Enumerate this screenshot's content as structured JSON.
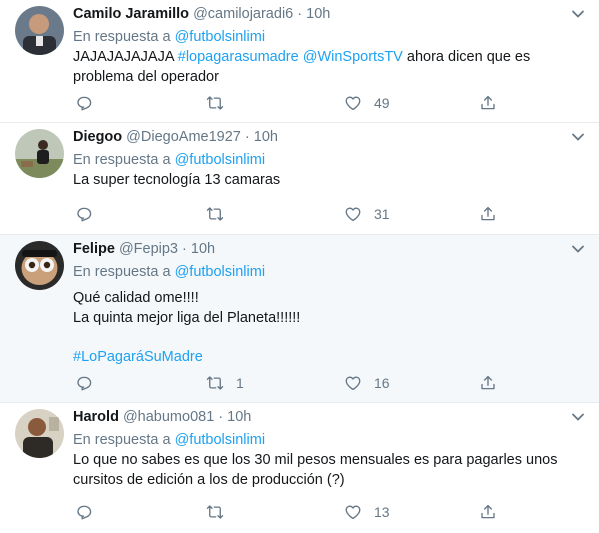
{
  "reply_prefix": "En respuesta a",
  "tweets": [
    {
      "name": "Camilo Jaramillo",
      "handle": "@camilojaradi6",
      "dot": "·",
      "time": "10h",
      "reply_to": "@futbolsinlimi",
      "text_html": "JAJAJAJAJAJA <span class=\"link\">#lopagarasumadre</span> <span class=\"link\">@WinSportsTV</span> ahora dicen que es problema del operador",
      "retweets": "",
      "likes": "49"
    },
    {
      "name": "Diegoo",
      "handle": "@DiegoAme1927",
      "dot": "·",
      "time": "10h",
      "reply_to": "@futbolsinlimi",
      "text_html": "La super tecnología 13 camaras",
      "retweets": "",
      "likes": "31"
    },
    {
      "name": "Felipe",
      "handle": "@Fepip3",
      "dot": "·",
      "time": "10h",
      "reply_to": "@futbolsinlimi",
      "text_html": "<p>Qué calidad ome!!!!</p><p>La quinta mejor liga del Planeta!!!!!!</p><p></p><p><span class=\"link\">#LoPagaráSuMadre</span></p>",
      "retweets": "1",
      "likes": "16"
    },
    {
      "name": "Harold",
      "handle": "@habumo081",
      "dot": "·",
      "time": "10h",
      "reply_to": "@futbolsinlimi",
      "text_html": "Lo que no sabes es que los 30 mil pesos mensuales es para pagarles unos cursitos de edición a los de producción (?)",
      "retweets": "",
      "likes": "13"
    }
  ],
  "colors": {
    "link": "#1da1f2",
    "muted": "#657786",
    "text": "#14171a",
    "highlight_bg": "#f5f8fa"
  },
  "icons": [
    "chevron-down-icon",
    "reply-icon",
    "retweet-icon",
    "like-icon",
    "share-icon"
  ]
}
